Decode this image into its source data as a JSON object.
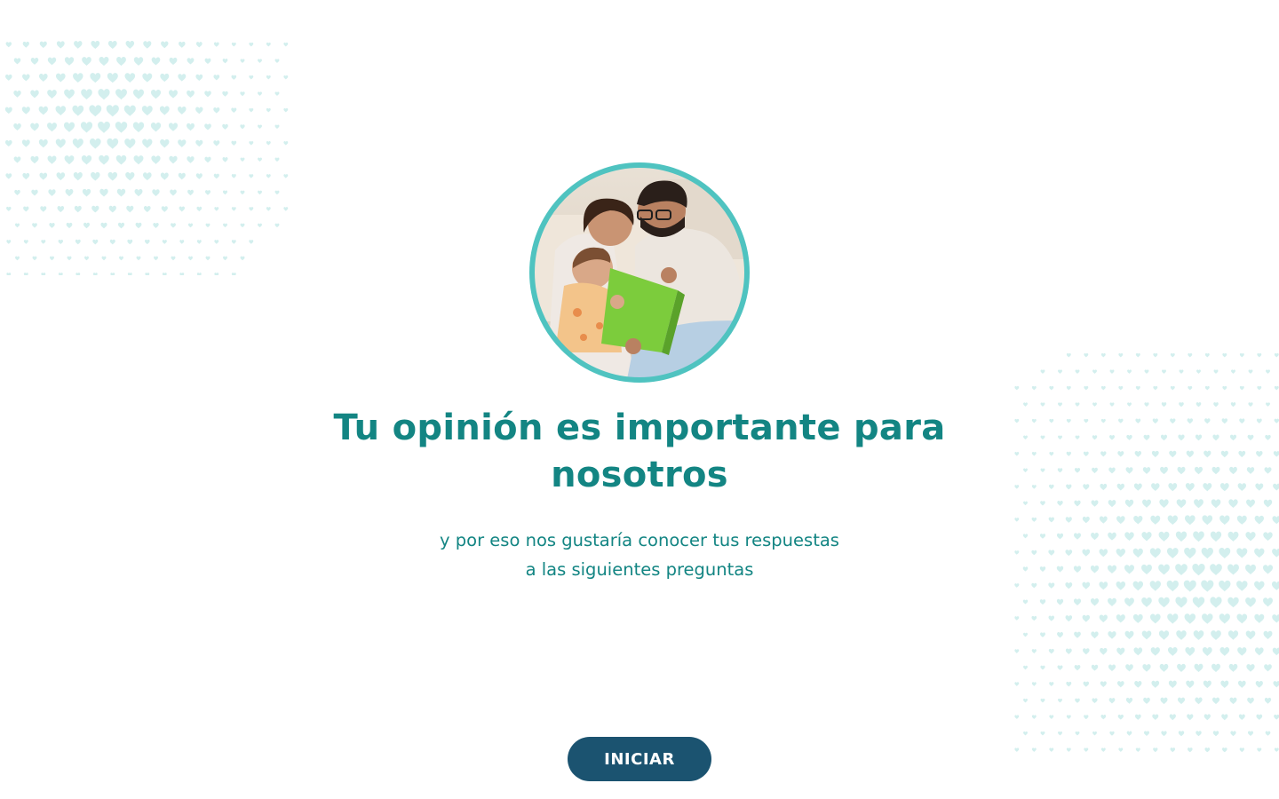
{
  "hero": {
    "title": "Tu opinión es importante para nosotros",
    "subtitle_line1": "y por eso nos gustaría conocer tus respuestas",
    "subtitle_line2": "a las siguientes preguntas"
  },
  "photo": {
    "subject": "family-reading-book-photo",
    "ring_color": "#4fc3c0"
  },
  "actions": {
    "start_label": "INICIAR"
  },
  "decorations": {
    "pattern": "heart-icon",
    "heart_color": "#d3efee"
  },
  "colors": {
    "accent_text": "#138583",
    "button_bg": "#1b5370",
    "button_text": "#ffffff",
    "background": "#ffffff"
  }
}
